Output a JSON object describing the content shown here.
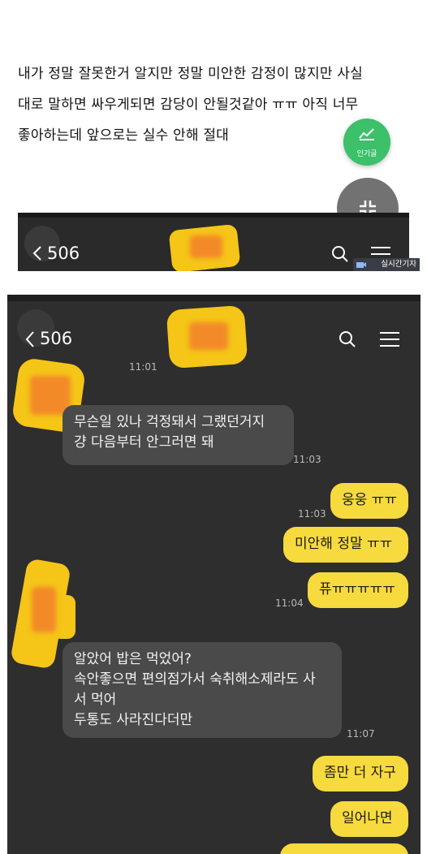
{
  "post": {
    "lines": [
      "내가 정말 잘못한거 알지만 정말 미안한 감정이 많지만 사실",
      "대로 말하면 싸우게되면 감당이 안될것같아 ㅠㅠ 아직 너무",
      "좋아하는데 앞으로는 실수 안해 절대"
    ]
  },
  "fab": {
    "popular_label": "인기글",
    "popular_icon": "trending-chart-icon",
    "shrink_icon": "collapse-icon",
    "popular_color": "#3cc06a"
  },
  "chat_header": {
    "back_icon": "chevron-left-icon",
    "count": "506",
    "search_icon": "search-icon",
    "menu_icon": "menu-icon"
  },
  "watermark": {
    "text": "실시간기자"
  },
  "messages": {
    "m0_time": "11:01",
    "m1_lines": [
      "무슨일 있나 걱정돼서 그랬던거지",
      "걍 다음부터 안그러면 돼"
    ],
    "m1_time": "11:03",
    "m2_text": "웅웅 ㅠㅠ",
    "m2_time": "11:03",
    "m3_text": "미안해 정말 ㅠㅠ",
    "m4_text": "퓨ㅠㅠㅠㅠㅠ",
    "m4_time": "11:04",
    "m5_lines": [
      "알았어 밥은 먹었어?",
      "속안좋으면 편의점가서 숙취해소제라도 사",
      "서 먹어",
      "두통도 사라진다더만"
    ],
    "m5_time": "11:07",
    "m6_text": "좀만 더 자구",
    "m7_text": "일어나면"
  },
  "colors": {
    "bg_dark": "#2e2e2e",
    "bubble_in": "#4a4a4a",
    "bubble_out": "#f7da3e"
  }
}
